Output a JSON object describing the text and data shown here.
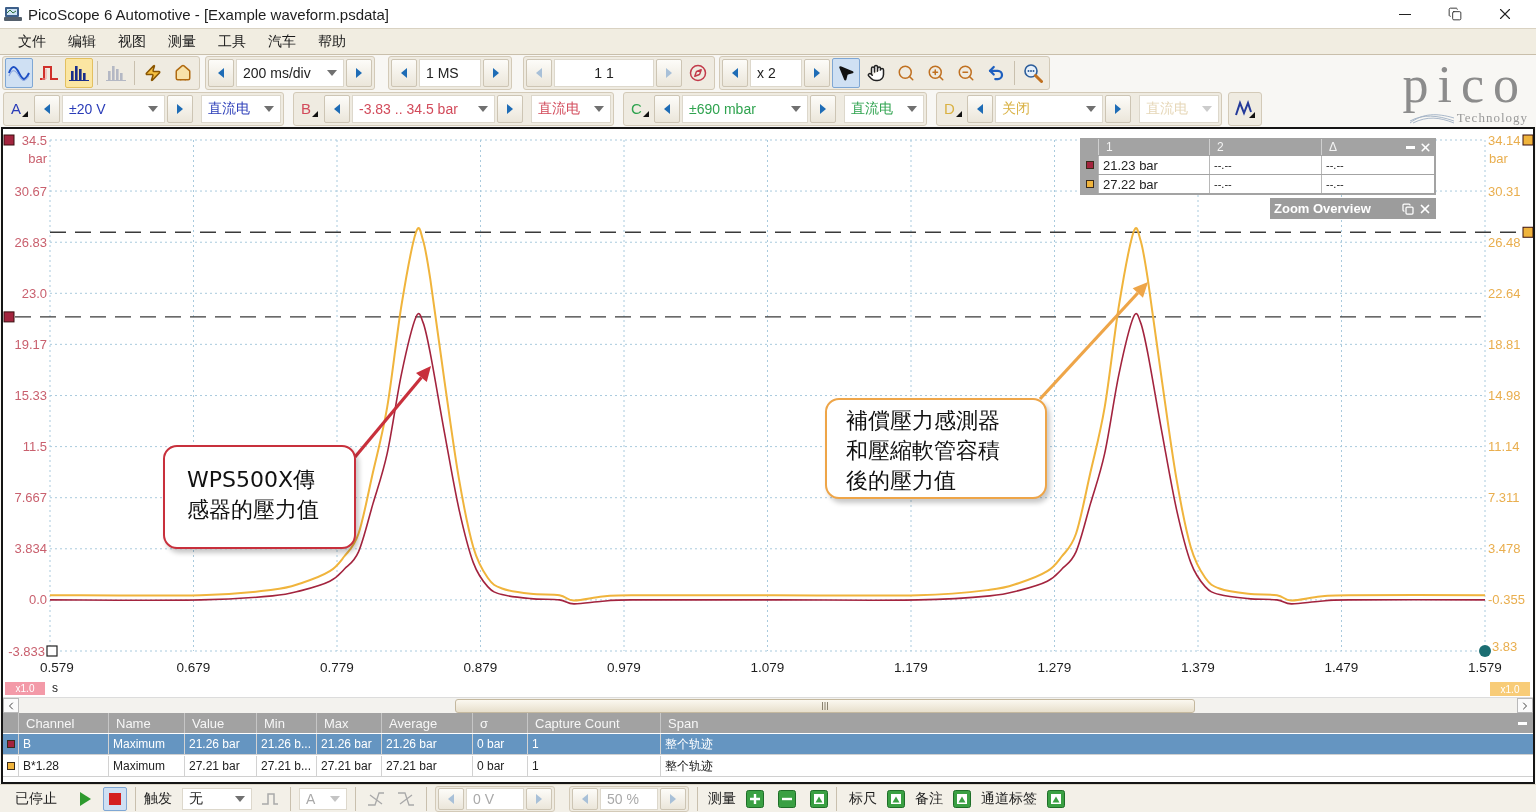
{
  "title_bar": {
    "title": "PicoScope 6 Automotive - [Example waveform.psdata]"
  },
  "menu": [
    "文件",
    "编辑",
    "视图",
    "测量",
    "工具",
    "汽车",
    "帮助"
  ],
  "toolbar": {
    "mode_buttons": [
      {
        "kind": "scope",
        "selected": true,
        "hovered": false
      },
      {
        "kind": "persistence",
        "selected": false,
        "hovered": false
      },
      {
        "kind": "spectrum",
        "selected": false,
        "hovered": true
      }
    ],
    "action_buttons": [
      {
        "kind": "spectrum-view",
        "disabled": true
      },
      {
        "kind": "auto-setup",
        "disabled": false
      },
      {
        "kind": "default-setup",
        "disabled": false
      }
    ],
    "timebase": "200 ms/div",
    "samples": "1 MS",
    "buffer": {
      "value": "1 1",
      "arrows_disabled": true
    },
    "zoom": "x 2",
    "tools": [
      {
        "kind": "pointer",
        "selected": true
      },
      {
        "kind": "hand",
        "selected": false
      },
      {
        "kind": "zoom-box",
        "selected": false
      },
      {
        "kind": "zoom-in",
        "selected": false
      },
      {
        "kind": "zoom-out",
        "selected": false
      }
    ]
  },
  "logo": {
    "name": "pico",
    "tagline": "Technology"
  },
  "channels": [
    {
      "letter": "A",
      "color": "#2a3cb8",
      "range": "±20 V",
      "coupling": "直流电",
      "coupling_disabled": false
    },
    {
      "letter": "B",
      "color": "#d24a5a",
      "range": "-3.83 .. 34.5 bar",
      "coupling": "直流电",
      "coupling_disabled": false
    },
    {
      "letter": "C",
      "color": "#2fa34f",
      "range": "±690 mbar",
      "coupling": "直流电",
      "coupling_disabled": false
    },
    {
      "letter": "D",
      "color": "#d9b143",
      "range": "关闭",
      "coupling": "直流电",
      "coupling_disabled": true
    }
  ],
  "scope": {
    "chart_data": {
      "type": "line",
      "grid": true,
      "xlabel": "s",
      "ylabel": "bar",
      "y2label": "bar",
      "xlim": [
        0.579,
        1.579
      ],
      "ylim": [
        -3.833,
        34.5
      ],
      "y2lim": [
        -4.188,
        34.14
      ],
      "xticks": [
        0.579,
        0.679,
        0.779,
        0.879,
        0.979,
        1.079,
        1.179,
        1.279,
        1.379,
        1.479,
        1.579
      ],
      "yticks": [
        {
          "value": 34.5,
          "label": "34.5"
        },
        {
          "value": 30.67,
          "label": "30.67"
        },
        {
          "value": 26.83,
          "label": "26.83"
        },
        {
          "value": 23.0,
          "label": "23.0"
        },
        {
          "value": 19.17,
          "label": "19.17"
        },
        {
          "value": 15.33,
          "label": "15.33"
        },
        {
          "value": 11.5,
          "label": "11.5"
        },
        {
          "value": 7.667,
          "label": "7.667"
        },
        {
          "value": 3.834,
          "label": "3.834"
        },
        {
          "value": 0.0,
          "label": "0.0"
        },
        {
          "value": -3.833,
          "label": "-3.833"
        }
      ],
      "y2ticks": [
        {
          "value": 34.14,
          "label": "34.14"
        },
        {
          "value": 30.31,
          "label": "30.31"
        },
        {
          "value": 26.48,
          "label": "26.48"
        },
        {
          "value": 22.64,
          "label": "22.64"
        },
        {
          "value": 18.81,
          "label": "18.81"
        },
        {
          "value": 14.98,
          "label": "14.98"
        },
        {
          "value": 11.14,
          "label": "11.14"
        },
        {
          "value": 7.311,
          "label": "7.311"
        },
        {
          "value": 3.478,
          "label": "3.478"
        },
        {
          "value": -0.355,
          "label": "-0.355"
        }
      ],
      "x": [
        0.579,
        0.684,
        0.734,
        0.754,
        0.774,
        0.784,
        0.794,
        0.804,
        0.814,
        0.824,
        0.834,
        0.839,
        0.844,
        0.854,
        0.864,
        0.874,
        0.884,
        0.894,
        0.914,
        0.934,
        0.944,
        0.964,
        0.984,
        1.084,
        1.184,
        1.234,
        1.254,
        1.274,
        1.284,
        1.294,
        1.304,
        1.314,
        1.324,
        1.334,
        1.339,
        1.344,
        1.354,
        1.364,
        1.374,
        1.384,
        1.394,
        1.414,
        1.434,
        1.444,
        1.464,
        1.484,
        1.579
      ],
      "series": [
        {
          "color": "#a3243e",
          "values": [
            0.0,
            0.0,
            0.3,
            0.7,
            1.4,
            2.3,
            3.6,
            7.2,
            11.0,
            17.0,
            21.2,
            20.8,
            18.5,
            12.5,
            6.8,
            2.8,
            1.0,
            0.4,
            0.1,
            0.0,
            -0.3,
            -0.1,
            0.0,
            0.0,
            0.0,
            0.3,
            0.7,
            1.4,
            2.3,
            3.6,
            7.2,
            11.0,
            17.0,
            21.2,
            20.8,
            18.5,
            12.5,
            6.8,
            2.8,
            1.0,
            0.4,
            0.1,
            0.0,
            -0.3,
            -0.1,
            0.0,
            0.0
          ]
        },
        {
          "color": "#f0b43c",
          "axis": "y2",
          "values": [
            0.0,
            0.0,
            0.4,
            0.9,
            1.8,
            2.9,
            4.6,
            9.2,
            14.1,
            21.8,
            27.2,
            26.6,
            23.7,
            16.0,
            8.7,
            3.6,
            1.3,
            0.5,
            0.1,
            0.0,
            -0.4,
            -0.1,
            0.0,
            0.0,
            0.0,
            0.4,
            0.9,
            1.8,
            2.9,
            4.6,
            9.2,
            14.1,
            21.8,
            27.2,
            26.6,
            23.7,
            16.0,
            8.7,
            3.6,
            1.3,
            0.5,
            0.1,
            0.0,
            -0.4,
            -0.1,
            0.0,
            0.0
          ]
        }
      ],
      "ref_lines": [
        {
          "axis": "y",
          "value": 21.23
        },
        {
          "axis": "y2",
          "value": 27.22
        }
      ]
    },
    "corner_label": "3.83",
    "zoom_badges": [
      {
        "text": "x1.0",
        "color": "#f39aa8"
      },
      {
        "text": "x1.0",
        "color": "#f8cc78"
      }
    ],
    "callouts": [
      {
        "text": "WPS500X傳感器的壓力值",
        "color": "#c8303c"
      },
      {
        "text": "補償壓力感測器和壓縮軟管容積後的壓力值",
        "color": "#eea548"
      }
    ],
    "rulers_panel": {
      "columns": [
        "1",
        "2",
        "Δ"
      ],
      "rows": [
        {
          "color": "#a3243e",
          "cells": [
            "21.23 bar",
            "--.--",
            "--.--"
          ]
        },
        {
          "color": "#f0b43c",
          "cells": [
            "27.22 bar",
            "--.--",
            "--.--"
          ]
        }
      ]
    },
    "zoom_overview": {
      "title": "Zoom Overview"
    }
  },
  "measurements": {
    "columns": [
      "Channel",
      "Name",
      "Value",
      "Min",
      "Max",
      "Average",
      "σ",
      "Capture Count",
      "Span"
    ],
    "rows": [
      {
        "selected": true,
        "color": "#a3243e",
        "cells": [
          "B",
          "Maximum",
          "21.26 bar",
          "21.26 b...",
          "21.26 bar",
          "21.26 bar",
          "0 bar",
          "1",
          "整个轨迹"
        ]
      },
      {
        "selected": false,
        "color": "#f0b43c",
        "cells": [
          "B*1.28",
          "Maximum",
          "27.21 bar",
          "27.21 b...",
          "27.21 bar",
          "27.21 bar",
          "0 bar",
          "1",
          "整个轨迹"
        ]
      }
    ]
  },
  "status_bar": {
    "state": "已停止",
    "run_buttons": [
      {
        "kind": "play",
        "selected": false
      },
      {
        "kind": "stop",
        "selected": true
      }
    ],
    "trigger": {
      "label": "触发",
      "mode": "无",
      "source": "A",
      "threshold": "0 V",
      "pre_trigger": "50 %",
      "disabled": true
    },
    "groups": [
      {
        "label": "测量",
        "buttons": [
          {
            "kind": "add"
          },
          {
            "kind": "remove"
          },
          {
            "kind": "edit"
          }
        ]
      },
      {
        "label": "标尺",
        "buttons": [
          {
            "kind": "edit"
          }
        ]
      },
      {
        "label": "备注",
        "buttons": [
          {
            "kind": "edit"
          }
        ]
      },
      {
        "label": "通道标签",
        "buttons": [
          {
            "kind": "edit"
          }
        ]
      }
    ]
  }
}
